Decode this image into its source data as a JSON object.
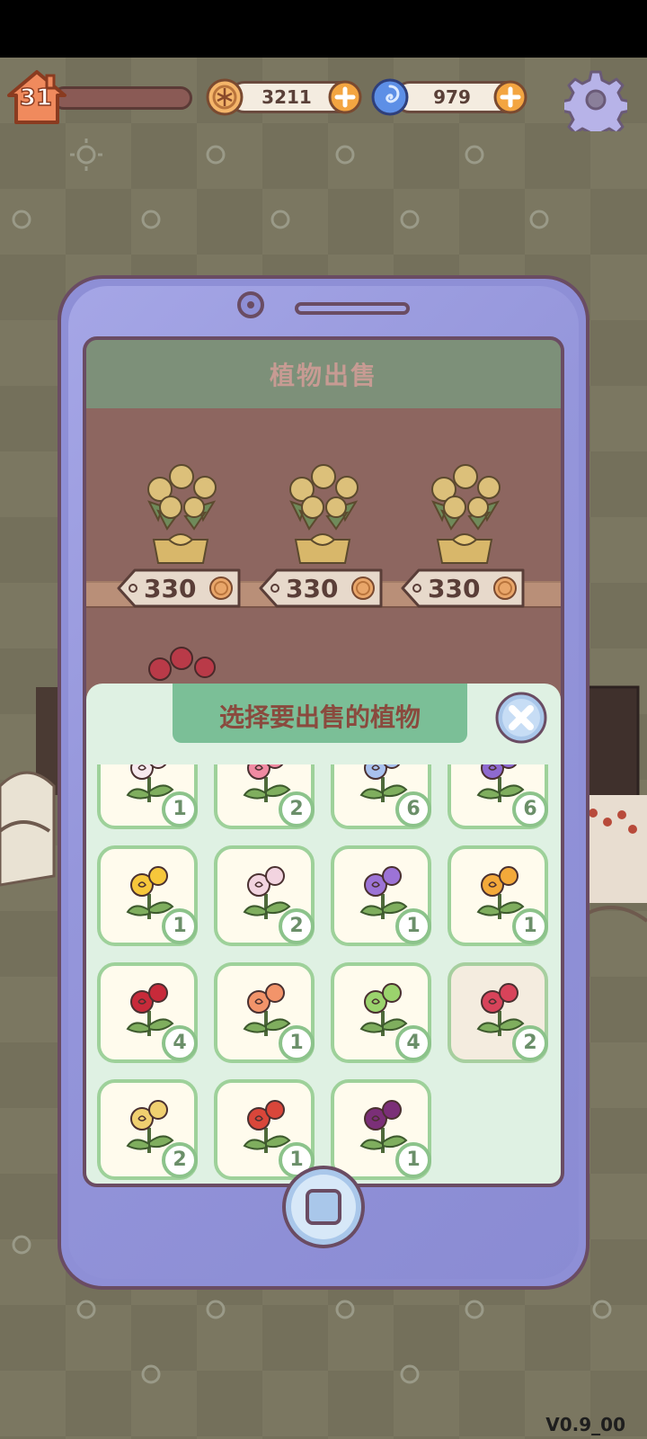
{
  "hud": {
    "level": "31",
    "coins": "3211",
    "gems": "979",
    "icons": {
      "level": "house-level-icon",
      "coin": "coin-icon",
      "gem": "swirl-gem-icon",
      "plus": "plus-icon",
      "settings": "gear-icon"
    }
  },
  "shop": {
    "title": "植物出售",
    "listings": [
      {
        "price": "330",
        "plant": "yellow-rose-bouquet"
      },
      {
        "price": "330",
        "plant": "yellow-rose-bouquet"
      },
      {
        "price": "330",
        "plant": "yellow-rose-bouquet"
      }
    ]
  },
  "panel": {
    "title": "选择要出售的植物",
    "close_icon": "close-icon",
    "items": [
      {
        "plant": "white-tulip",
        "count": "1",
        "color": "#f7e9ee"
      },
      {
        "plant": "pink-anthurium",
        "count": "2",
        "color": "#f08aa2"
      },
      {
        "plant": "blue-rose",
        "count": "6",
        "color": "#a9c1ee"
      },
      {
        "plant": "purple-rose",
        "count": "6",
        "color": "#8e6ad0"
      },
      {
        "plant": "daffodil",
        "count": "1",
        "color": "#f6c73b"
      },
      {
        "plant": "white-lily",
        "count": "2",
        "color": "#f2d4e0"
      },
      {
        "plant": "purple-lotus",
        "count": "1",
        "color": "#9c73d6"
      },
      {
        "plant": "bird-of-paradise",
        "count": "1",
        "color": "#f3a93a"
      },
      {
        "plant": "red-rose",
        "count": "4",
        "color": "#c82a3a"
      },
      {
        "plant": "orange-rose",
        "count": "1",
        "color": "#f2946a"
      },
      {
        "plant": "green-rose",
        "count": "4",
        "color": "#9bd36d"
      },
      {
        "plant": "red-white-rose",
        "count": "2",
        "color": "#d8435a"
      },
      {
        "plant": "yellow-rose",
        "count": "2",
        "color": "#f0d070"
      },
      {
        "plant": "red-bird-of-paradise",
        "count": "1",
        "color": "#d9463a"
      },
      {
        "plant": "dark-purple-rose",
        "count": "1",
        "color": "#7b2f78"
      }
    ]
  },
  "home_button_icon": "home-square-icon",
  "version": "V0.9_00"
}
